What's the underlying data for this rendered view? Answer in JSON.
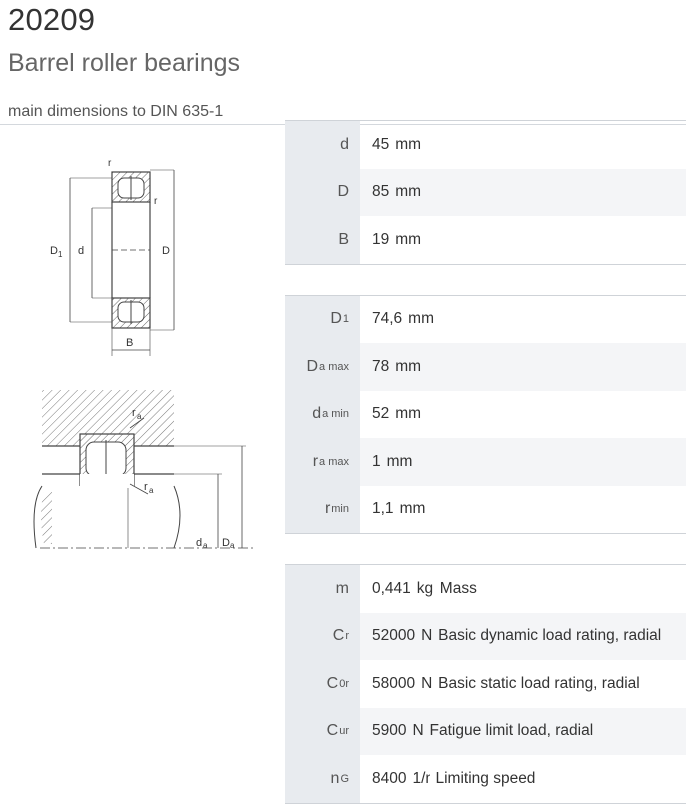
{
  "header": {
    "designation": "20209",
    "type": "Barrel roller bearings",
    "caption": "main dimensions to DIN 635-1"
  },
  "drawing1": {
    "labels": {
      "r_top": "r",
      "r_side": "r",
      "D1": "D",
      "D1_sub": "1",
      "d": "d",
      "D": "D",
      "B": "B"
    }
  },
  "drawing2": {
    "labels": {
      "ra_top": "r",
      "ra_top_sub": "a",
      "ra_bottom": "r",
      "ra_bottom_sub": "a",
      "da": "d",
      "da_sub": "a",
      "Da": "D",
      "Da_sub": "a"
    }
  },
  "table1": [
    {
      "sym": "d",
      "sub": "",
      "value": "45",
      "unit": "mm",
      "desc": ""
    },
    {
      "sym": "D",
      "sub": "",
      "value": "85",
      "unit": "mm",
      "desc": ""
    },
    {
      "sym": "B",
      "sub": "",
      "value": "19",
      "unit": "mm",
      "desc": ""
    }
  ],
  "table2": [
    {
      "sym": "D",
      "sub": "1",
      "value": "74,6",
      "unit": "mm",
      "desc": ""
    },
    {
      "sym": "D",
      "sub": "a max",
      "value": "78",
      "unit": "mm",
      "desc": ""
    },
    {
      "sym": "d",
      "sub": "a min",
      "value": "52",
      "unit": "mm",
      "desc": ""
    },
    {
      "sym": "r",
      "sub": "a max",
      "value": "1",
      "unit": "mm",
      "desc": ""
    },
    {
      "sym": "r",
      "sub": "min",
      "value": "1,1",
      "unit": "mm",
      "desc": ""
    }
  ],
  "table3": [
    {
      "sym": "m",
      "sub": "",
      "value": "0,441",
      "unit": "kg",
      "desc": "Mass"
    },
    {
      "sym": "C",
      "sub": "r",
      "value": "52000",
      "unit": "N",
      "desc": "Basic dynamic load rating, radial"
    },
    {
      "sym": "C",
      "sub": "0r",
      "value": "58000",
      "unit": "N",
      "desc": "Basic static load rating, radial"
    },
    {
      "sym": "C",
      "sub": "ur",
      "value": "5900",
      "unit": "N",
      "desc": "Fatigue limit load, radial"
    },
    {
      "sym": "n",
      "sub": "G",
      "value": "8400",
      "unit": "1/m",
      "desc": "Limiting speed"
    }
  ]
}
